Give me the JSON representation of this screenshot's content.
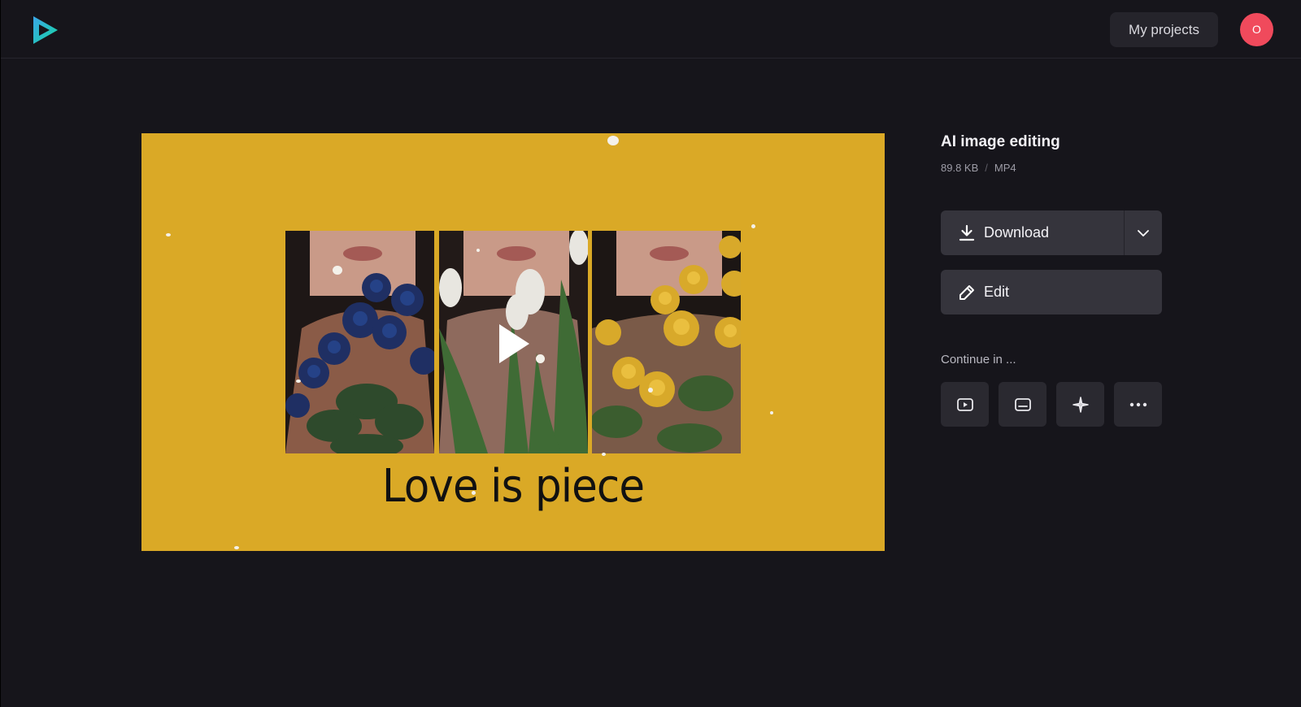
{
  "header": {
    "logo_icon": "play-triangle-logo-icon",
    "my_projects_label": "My projects",
    "avatar_initial": "O"
  },
  "preview": {
    "caption": "Love is piece",
    "background_color": "#daa926",
    "panels": [
      {
        "icon": "blue-roses-photo"
      },
      {
        "icon": "white-tulips-photo"
      },
      {
        "icon": "yellow-roses-photo"
      }
    ],
    "play_icon": "play-icon"
  },
  "details": {
    "title": "AI image editing",
    "size": "89.8 KB",
    "separator": "/",
    "format": "MP4"
  },
  "actions": {
    "download_label": "Download",
    "download_icon": "download-icon",
    "dropdown_icon": "chevron-down-icon",
    "edit_label": "Edit",
    "edit_icon": "pencil-icon"
  },
  "continue_in": {
    "label": "Continue in ...",
    "tools": [
      {
        "icon": "video-player-icon"
      },
      {
        "icon": "subtitles-icon"
      },
      {
        "icon": "sparkle-icon"
      },
      {
        "icon": "more-icon"
      }
    ]
  },
  "colors": {
    "accent": "#f04a5c",
    "background": "#16151b",
    "button": "#35343c"
  }
}
